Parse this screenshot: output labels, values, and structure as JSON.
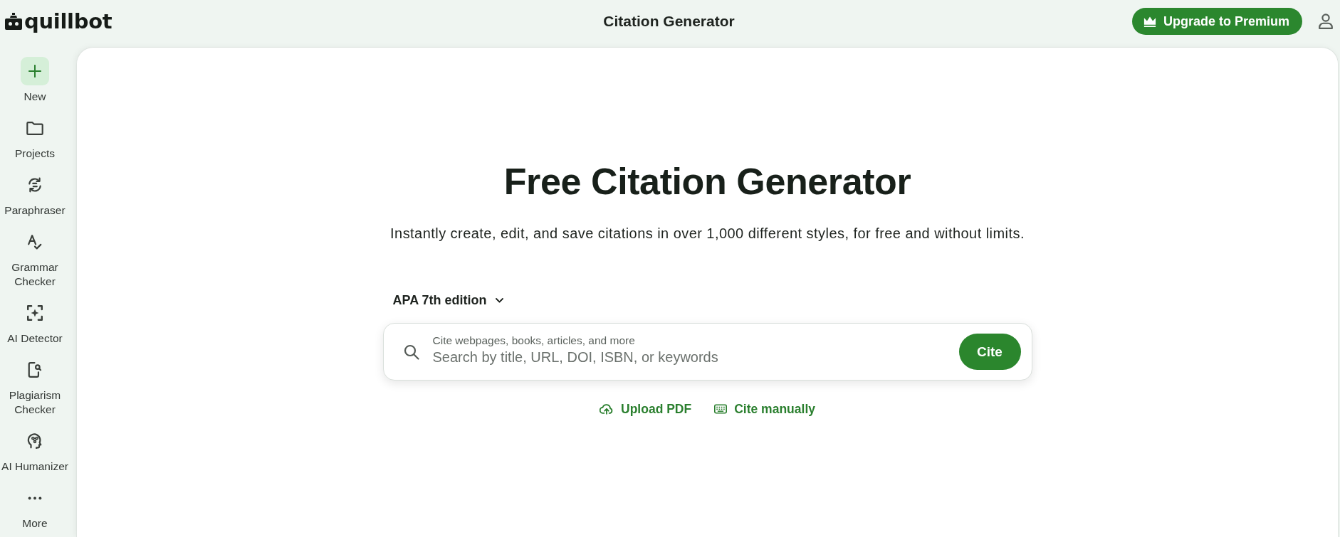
{
  "header": {
    "logo": "quillbot",
    "title": "Citation Generator",
    "upgrade_button": "Upgrade to Premium"
  },
  "sidebar": {
    "items": [
      {
        "label": "New",
        "kind": "primary"
      },
      {
        "label": "Projects",
        "kind": "link"
      },
      {
        "label": "Paraphraser",
        "kind": "link"
      },
      {
        "label": "Grammar Checker",
        "kind": "link"
      },
      {
        "label": "AI Detector",
        "kind": "link"
      },
      {
        "label": "Plagiarism Checker",
        "kind": "link"
      },
      {
        "label": "AI Humanizer",
        "kind": "link"
      },
      {
        "label": "More",
        "kind": "link"
      }
    ]
  },
  "main": {
    "heading": "Free Citation Generator",
    "subheading": "Instantly create, edit, and save citations in over 1,000 different styles, for free and without limits.",
    "style_dropdown": "APA 7th edition",
    "search": {
      "label": "Cite webpages, books, articles, and more",
      "placeholder": "Search by title, URL, DOI, ISBN, or keywords",
      "button": "Cite"
    },
    "actions": [
      {
        "label": "Upload PDF"
      },
      {
        "label": "Cite manually"
      }
    ]
  }
}
